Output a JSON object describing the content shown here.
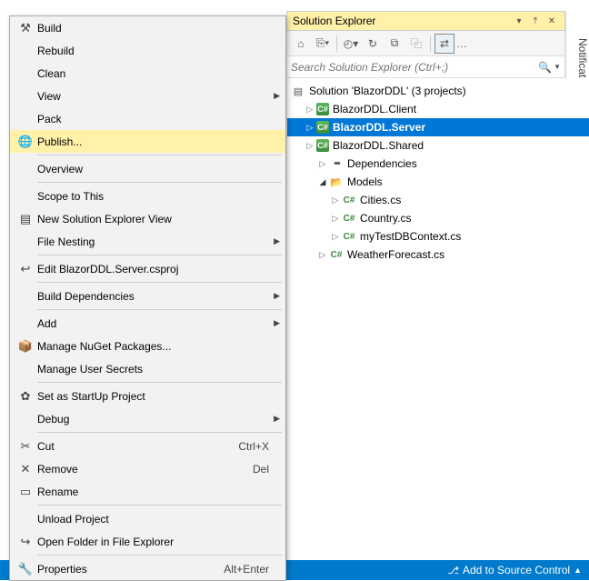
{
  "panel": {
    "title": "Solution Explorer"
  },
  "search": {
    "placeholder": "Search Solution Explorer (Ctrl+;)"
  },
  "notifications": {
    "label": "Notifications"
  },
  "solution": {
    "label": "Solution 'BlazorDDL' (3 projects)",
    "projects": [
      {
        "name": "BlazorDDL.Client"
      },
      {
        "name": "BlazorDDL.Server",
        "selected": true
      },
      {
        "name": "BlazorDDL.Shared"
      }
    ],
    "server_children": {
      "dependencies": "Dependencies",
      "models": "Models",
      "model_files": [
        "Cities.cs",
        "Country.cs",
        "myTestDBContext.cs"
      ],
      "roots": [
        "WeatherForecast.cs"
      ]
    }
  },
  "context_menu": {
    "groups": [
      [
        {
          "icon": "build-icon",
          "glyph": "⚒",
          "label": "Build"
        },
        {
          "label": "Rebuild"
        },
        {
          "label": "Clean"
        },
        {
          "label": "View",
          "submenu": true
        },
        {
          "label": "Pack"
        },
        {
          "icon": "publish-icon",
          "glyph": "🌐",
          "label": "Publish...",
          "highlight": true
        }
      ],
      [
        {
          "label": "Overview"
        }
      ],
      [
        {
          "label": "Scope to This"
        },
        {
          "icon": "new-solution-view-icon",
          "glyph": "▤",
          "label": "New Solution Explorer View"
        },
        {
          "label": "File Nesting",
          "submenu": true
        }
      ],
      [
        {
          "icon": "edit-csproj-icon",
          "glyph": "↩",
          "label": "Edit BlazorDDL.Server.csproj"
        }
      ],
      [
        {
          "label": "Build Dependencies",
          "submenu": true
        }
      ],
      [
        {
          "label": "Add",
          "submenu": true
        },
        {
          "icon": "nuget-icon",
          "glyph": "📦",
          "label": "Manage NuGet Packages..."
        },
        {
          "label": "Manage User Secrets"
        }
      ],
      [
        {
          "icon": "startup-icon",
          "glyph": "✿",
          "label": "Set as StartUp Project"
        },
        {
          "label": "Debug",
          "submenu": true
        }
      ],
      [
        {
          "icon": "cut-icon",
          "glyph": "✂",
          "label": "Cut",
          "shortcut": "Ctrl+X"
        },
        {
          "icon": "remove-icon",
          "glyph": "✕",
          "label": "Remove",
          "shortcut": "Del"
        },
        {
          "icon": "rename-icon",
          "glyph": "▭",
          "label": "Rename"
        }
      ],
      [
        {
          "label": "Unload Project"
        },
        {
          "icon": "open-folder-icon",
          "glyph": "↪",
          "label": "Open Folder in File Explorer"
        }
      ],
      [
        {
          "icon": "properties-icon",
          "glyph": "🔧",
          "label": "Properties",
          "shortcut": "Alt+Enter"
        }
      ]
    ]
  },
  "status": {
    "add_source_control": "Add to Source Control"
  }
}
